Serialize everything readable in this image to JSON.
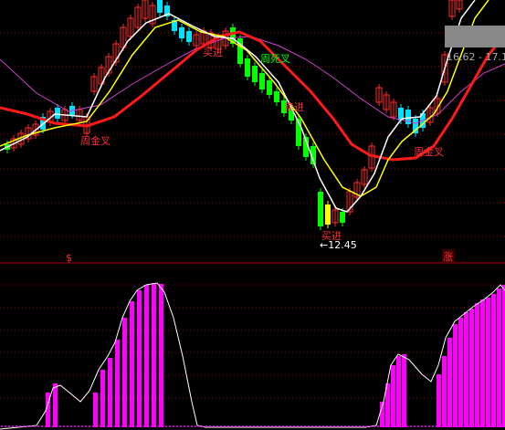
{
  "chart_data": [
    {
      "type": "candlestick",
      "panel": "price",
      "annotations": [
        {
          "text": "周金叉",
          "color": "#ff3030"
        },
        {
          "text": "买进",
          "color": "#ff3030"
        },
        {
          "text": "周死叉",
          "color": "#00ff00"
        },
        {
          "text": "卖进",
          "color": "#ff3030"
        },
        {
          "text": "买进",
          "color": "#ff3030"
        },
        {
          "text": "←12.45",
          "color": "#ffffff"
        },
        {
          "text": "周金叉",
          "color": "#ff3030"
        }
      ],
      "price_box": "16.62 - 17.1",
      "low_marker": {
        "label": "←12.45",
        "value": 12.45
      },
      "moving_average_colors": {
        "white": "#ffffff",
        "yellow": "#ffff00",
        "red": "#ff1a1a",
        "magenta": "#d040d0"
      },
      "candle_colors": {
        "up": "#ff2a2a",
        "down_cyan": "#00e0ff",
        "down_green": "#00ff00",
        "doji": "#ffff00"
      }
    },
    {
      "type": "indicator",
      "panel": "lower",
      "markers": [
        {
          "text": "$",
          "color": "#ff3030"
        },
        {
          "text": "涨",
          "color": "#ff3030"
        }
      ],
      "line_color": "#ffffff",
      "bar_color": "#ff00ff",
      "baseline_dots": true
    }
  ],
  "labels": {
    "cross1": "周金叉",
    "buy1": "买进",
    "death": "周死叉",
    "sell": "卖进",
    "buy2": "买进",
    "low": "←12.45",
    "cross2": "周金叉",
    "price_box": "16.62 - 17.1",
    "dollar": "$",
    "zhang": "涨"
  }
}
